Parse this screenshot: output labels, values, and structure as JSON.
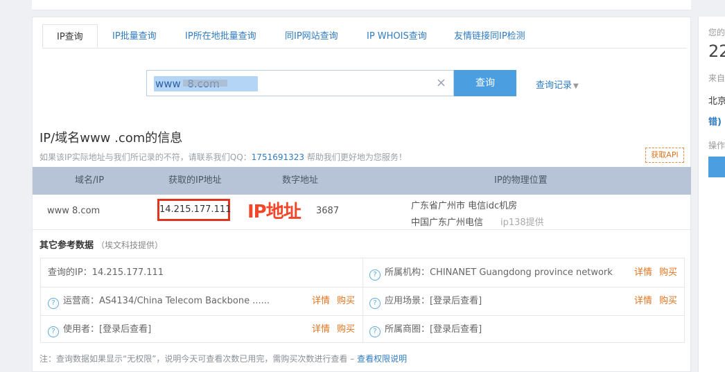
{
  "tabs": [
    "IP查询",
    "IP批量查询",
    "IP所在地批量查询",
    "同IP网站查询",
    "IP WHOIS查询",
    "友情链接同IP检测"
  ],
  "search": {
    "value": "www  8.com",
    "clear_icon": "×",
    "button": "查询",
    "history": "查询记录"
  },
  "info": {
    "title": "IP/域名www .com的信息",
    "notice_pre": "如果该IP实际地址与我们所记录的不符，请联系我们QQ：",
    "qq": "1751691323",
    "notice_post": " 帮助我们更好地为您服务！",
    "api_button": "获取API"
  },
  "table": {
    "headers": [
      "域名/IP",
      "获取的IP地址",
      "数字地址",
      "IP的物理位置"
    ],
    "row": {
      "domain": "www 8.com",
      "ip": "14.215.177.111",
      "numeric": "3687",
      "location1": "广东省广州市 电信idc机房",
      "location2": "中国广东广州电信",
      "provider": "ip138提供"
    }
  },
  "annotation": "IP地址",
  "ref": {
    "title": "其它参考数据",
    "subtitle": "（埃文科技提供）",
    "rows": [
      {
        "left_label": "查询的IP：14.215.177.111",
        "right_label": "所属机构：CHINANET Guangdong province network"
      },
      {
        "left_label": "运营商：AS4134/China Telecom Backbone ......",
        "right_label": "应用场景：[登录后查看]"
      },
      {
        "left_label": "使用者：[登录后查看]",
        "right_label": "所属商圈：[登录后查看]"
      }
    ],
    "detail": "详情",
    "buy": "购买"
  },
  "footer": {
    "text": "注：查询数据如果显示“无权限”，说明今天可查看次数已用完，需购买次数进行查看 – ",
    "link": "查看权限说明"
  },
  "sidebar": {
    "t1": "您的",
    "t2": "22",
    "t3": "来自",
    "t4": "北京",
    "t5": "错)",
    "t6": "操作"
  },
  "colors": {
    "accent": "#4b9fe1",
    "link": "#2f7bc2",
    "orange": "#e2731d",
    "highlight": "#e0341f"
  }
}
